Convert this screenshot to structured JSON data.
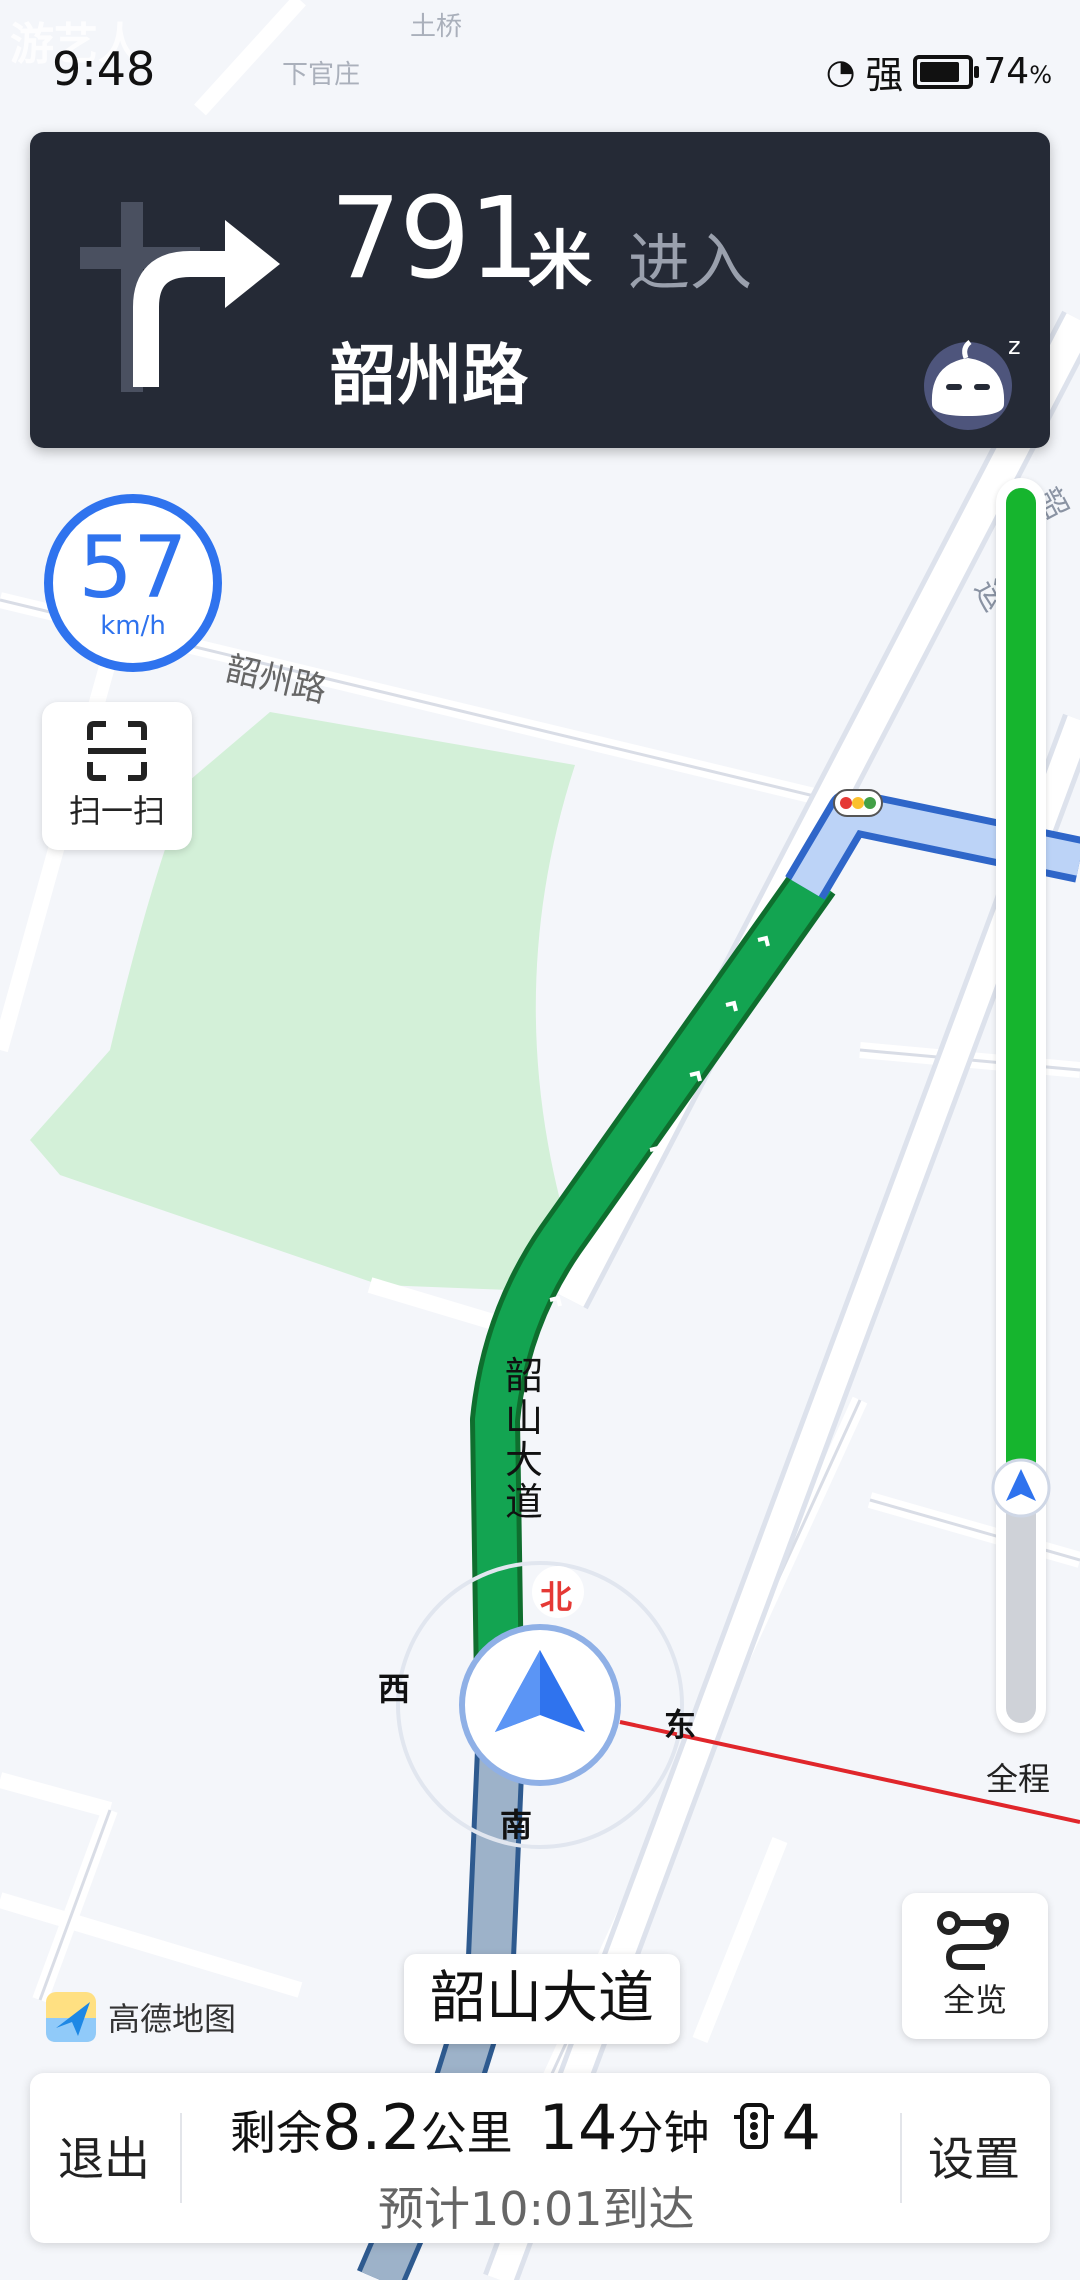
{
  "status_bar": {
    "time": "9:48",
    "signal_text": "强",
    "battery_level": 0.74,
    "battery_percent": "74",
    "percent_sign": "%"
  },
  "watermark": "游艺人",
  "map": {
    "labels": {
      "tuqiao": "土桥",
      "xiaguanzhuang": "下官庄",
      "shaozhoulu": "韶州路",
      "road_vertical": [
        "韶",
        "山",
        "大",
        "道"
      ],
      "north": "北",
      "west": "西",
      "east": "东",
      "south": "南",
      "far_right_1": "韶",
      "far_right_2": "运"
    }
  },
  "nav_card": {
    "distance": "791",
    "unit": "米",
    "action": "进入",
    "road": "韶州路"
  },
  "speed": {
    "value": "57",
    "unit": "km/h"
  },
  "scan_button": {
    "label": "扫一扫"
  },
  "route_progress": {
    "fraction_green": 0.81,
    "label": "全程"
  },
  "overview_button": {
    "label": "全览"
  },
  "current_road": "韶山大道",
  "logo_text": "高德地图",
  "bottom_bar": {
    "exit": "退出",
    "remaining_prefix": "剩余",
    "remaining_distance": "8.2",
    "distance_unit": "公里",
    "remaining_time": "14",
    "time_unit": "分钟",
    "traffic_lights": "4",
    "eta": "预计10:01到达",
    "settings": "设置"
  },
  "colors": {
    "accent_blue": "#2f73ee",
    "route_green": "#16b52e",
    "card_dark": "#252a36"
  }
}
